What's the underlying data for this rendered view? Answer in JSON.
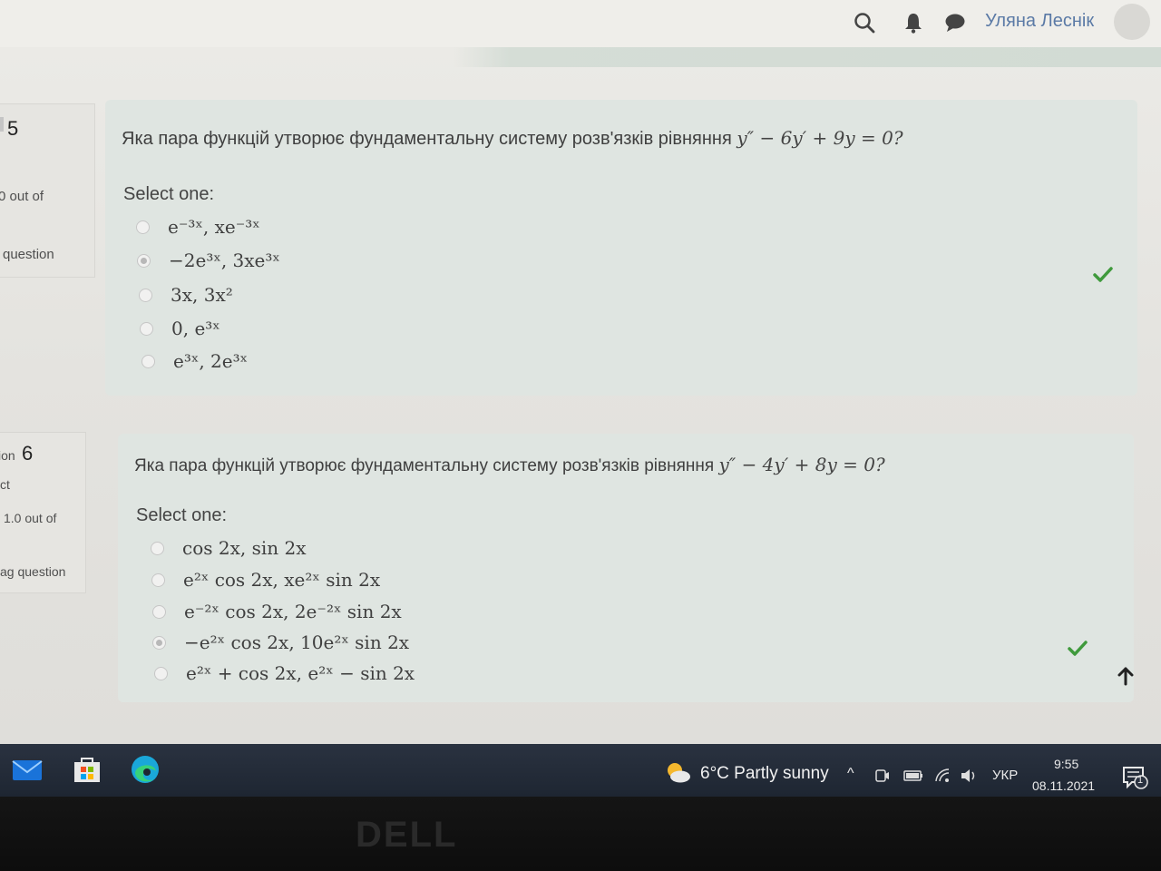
{
  "header": {
    "user_name": "Уляна Леснік",
    "icons": [
      "search-icon",
      "bell-icon",
      "chat-icon",
      "avatar"
    ]
  },
  "questions": [
    {
      "info": {
        "number": "5",
        "grade": "0 out of",
        "flag": "question"
      },
      "text": "Яка пара функцій утворює фундаментальну систему розв'язків рівняння",
      "equation": "y″ − 6y′ + 9y = 0?",
      "select_label": "Select one:",
      "options": [
        {
          "label": "e⁻³ˣ,  xe⁻³ˣ",
          "selected": false
        },
        {
          "label": "−2e³ˣ,  3xe³ˣ",
          "selected": true
        },
        {
          "label": "3x,  3x²",
          "selected": false
        },
        {
          "label": "0,  e³ˣ",
          "selected": false
        },
        {
          "label": "e³ˣ,  2e³ˣ",
          "selected": false
        }
      ],
      "status_icon": "checkmark-icon"
    },
    {
      "info": {
        "number": "6",
        "prefix": "ion",
        "status": "ct",
        "grade": "1.0 out of",
        "flag": "ag question"
      },
      "text": "Яка пара функцій утворює фундаментальну систему розв'язків рівняння",
      "equation": "y″ − 4y′ + 8y = 0?",
      "select_label": "Select one:",
      "options": [
        {
          "label": "cos 2x,  sin 2x",
          "selected": false
        },
        {
          "label": "e²ˣ cos 2x,  xe²ˣ sin 2x",
          "selected": false
        },
        {
          "label": "e⁻²ˣ cos 2x,  2e⁻²ˣ sin 2x",
          "selected": false
        },
        {
          "label": "−e²ˣ cos 2x,  10e²ˣ sin 2x",
          "selected": true
        },
        {
          "label": "e²ˣ + cos 2x,  e²ˣ − sin 2x",
          "selected": false
        }
      ],
      "status_icon": "checkmark-icon"
    }
  ],
  "taskbar": {
    "weather": "6°C  Partly sunny",
    "language": "УКР",
    "time": "9:55",
    "date": "08.11.2021",
    "notification_count": "1"
  },
  "bezel": {
    "brand": "DELL"
  }
}
